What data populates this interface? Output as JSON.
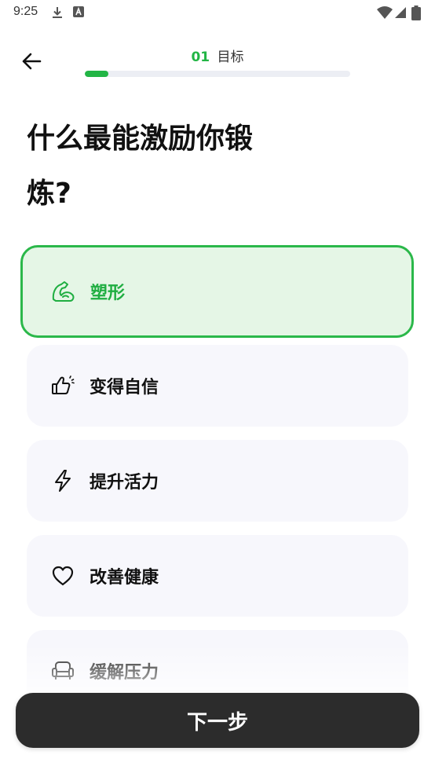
{
  "status_bar": {
    "time": "9:25",
    "icons": [
      "download-icon",
      "font-a-icon",
      "wifi-icon",
      "signal-icon",
      "battery-icon"
    ]
  },
  "header": {
    "step_number": "01",
    "step_title": "目标",
    "progress_fraction": 0.09
  },
  "question": "什么最能激励你锻炼?",
  "options": [
    {
      "label": "塑形",
      "icon": "flexed-arm-icon",
      "selected": true
    },
    {
      "label": "变得自信",
      "icon": "thumbs-up-icon",
      "selected": false
    },
    {
      "label": "提升活力",
      "icon": "lightning-icon",
      "selected": false
    },
    {
      "label": "改善健康",
      "icon": "heart-icon",
      "selected": false
    },
    {
      "label": "缓解压力",
      "icon": "armchair-icon",
      "selected": false
    }
  ],
  "next_button": {
    "label": "下一步"
  },
  "colors": {
    "accent": "#22b545",
    "selected_bg": "#e5f6e6",
    "option_bg": "#f7f7fc",
    "button_bg": "#2c2c2c"
  }
}
